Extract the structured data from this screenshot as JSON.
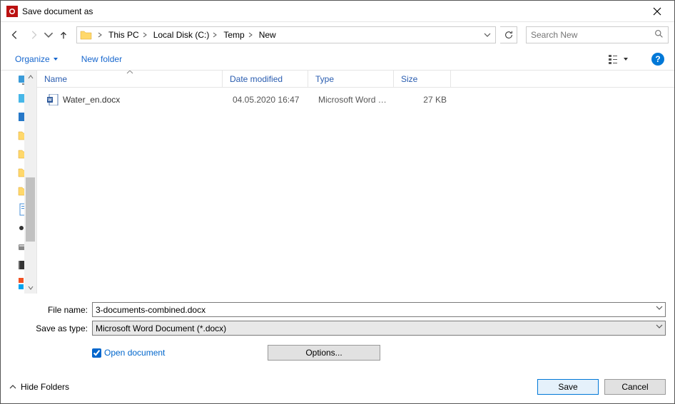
{
  "window": {
    "title": "Save document as"
  },
  "nav": {
    "breadcrumbs": [
      "This PC",
      "Local Disk (C:)",
      "Temp",
      "New"
    ],
    "search_placeholder": "Search New"
  },
  "toolbar": {
    "organize": "Organize",
    "new_folder": "New folder"
  },
  "columns": {
    "name": "Name",
    "date": "Date modified",
    "type": "Type",
    "size": "Size"
  },
  "files": [
    {
      "name": "Water_en.docx",
      "date": "04.05.2020 16:47",
      "type": "Microsoft Word D...",
      "size": "27 KB"
    }
  ],
  "form": {
    "filename_label": "File name:",
    "filename_value": "3-documents-combined.docx",
    "savetype_label": "Save as type:",
    "savetype_value": "Microsoft Word Document (*.docx)",
    "open_doc_label": "Open document",
    "options_label": "Options..."
  },
  "footer": {
    "hide_folders": "Hide Folders",
    "save": "Save",
    "cancel": "Cancel"
  }
}
